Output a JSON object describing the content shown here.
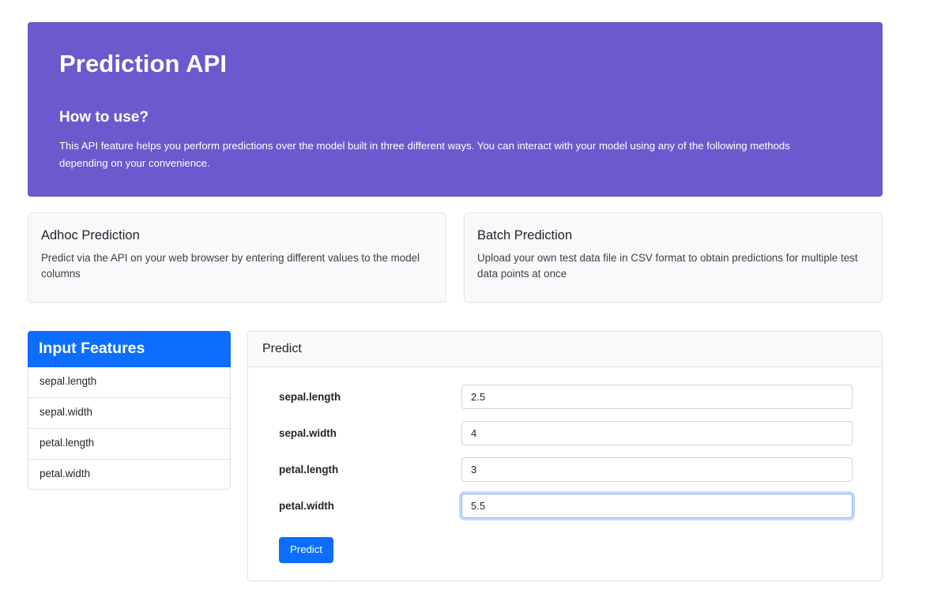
{
  "hero": {
    "title": "Prediction API",
    "subtitle": "How to use?",
    "description": "This API feature helps you perform predictions over the model built in three different ways. You can interact with your model using any of the following methods depending on your convenience.",
    "background_color": "#6a5acd"
  },
  "info_cards": [
    {
      "title": "Adhoc Prediction",
      "text": "Predict via the API on your web browser by entering different values to the model columns"
    },
    {
      "title": "Batch Prediction",
      "text": "Upload your own test data file in CSV format to obtain predictions for multiple test data points at once"
    }
  ],
  "features_panel": {
    "header": "Input Features",
    "header_color": "#0d6efd",
    "items": [
      {
        "label": "sepal.length"
      },
      {
        "label": "sepal.width"
      },
      {
        "label": "petal.length"
      },
      {
        "label": "petal.width"
      }
    ]
  },
  "predict_panel": {
    "header": "Predict",
    "fields": [
      {
        "label": "sepal.length",
        "value": "2.5",
        "placeholder": "",
        "focused": false
      },
      {
        "label": "sepal.width",
        "value": "4",
        "placeholder": "",
        "focused": false
      },
      {
        "label": "petal.length",
        "value": "3",
        "placeholder": "",
        "focused": false
      },
      {
        "label": "petal.width",
        "value": "5.5",
        "placeholder": "",
        "focused": true
      }
    ],
    "submit_label": "Predict",
    "submit_color": "#0d6efd"
  }
}
